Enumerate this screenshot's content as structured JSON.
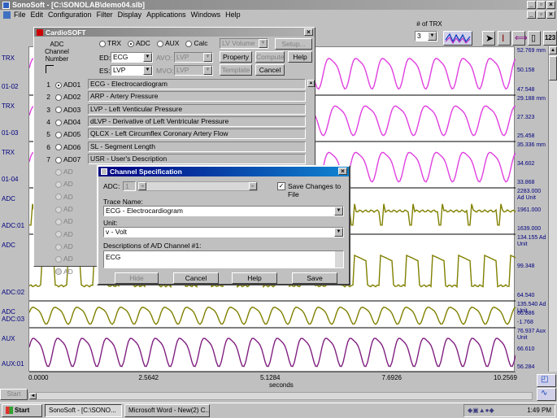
{
  "window": {
    "title": "SonoSoft - [C:\\SONOLAB\\demo04.slb]"
  },
  "menu": [
    "File",
    "Edit",
    "Configuration",
    "Filter",
    "Display",
    "Applications",
    "Windows",
    "Help"
  ],
  "toolbar": {
    "trx_count_label": "# of TRX",
    "trx_count_value": "3",
    "badge": "123"
  },
  "tracks": [
    {
      "name": "trx-1",
      "color": "#e040e0",
      "left_labels": [
        "TRX",
        "01-02"
      ],
      "right_labels": [
        "52.769 mm",
        "50.158",
        "47.548"
      ]
    },
    {
      "name": "trx-2",
      "color": "#e040e0",
      "left_labels": [
        "TRX",
        "01-03"
      ],
      "right_labels": [
        "29.188 mm",
        "27.323",
        "25.458"
      ]
    },
    {
      "name": "trx-3",
      "color": "#e040e0",
      "left_labels": [
        "TRX",
        "01-04"
      ],
      "right_labels": [
        "35.336 mm",
        "34.602",
        "33.868"
      ]
    },
    {
      "name": "adc-1",
      "color": "#808000",
      "left_labels": [
        "ADC",
        "ADC:01"
      ],
      "right_labels": [
        "2283.000 Ad Unit",
        "1961.000",
        "1639.000"
      ]
    },
    {
      "name": "adc-2",
      "color": "#808000",
      "left_labels": [
        "ADC",
        "ADC:02"
      ],
      "right_labels": [
        "134.155 Ad Unit",
        "99.348",
        "64.540"
      ]
    },
    {
      "name": "adc-3",
      "color": "#808000",
      "left_labels": [
        "ADC",
        "ADC:03"
      ],
      "right_labels": [
        "135.540 Ad Unit",
        "66.886",
        "-1.768"
      ]
    },
    {
      "name": "aux-1",
      "color": "#802080",
      "left_labels": [
        "AUX",
        "AUX:01"
      ],
      "right_labels": [
        "76.937 Aux Unit",
        "66.610",
        "56.284"
      ]
    }
  ],
  "x_axis": {
    "ticks": [
      "0.0000",
      "2.5642",
      "5.1284",
      "7.6926",
      "10.2569"
    ],
    "label": "seconds"
  },
  "sidebar": {
    "start_label": "Start"
  },
  "cardiosoft": {
    "title": "CardioSOFT",
    "adc_label": "ADC Channel Number",
    "modes": [
      "TRX",
      "ADC",
      "AUX",
      "Calc"
    ],
    "selected_mode": "ADC",
    "lv_volume": "LV Volume",
    "setup_label": "Setup...",
    "ed_label": "ED:",
    "ed_value": "ECG",
    "es_label": "ES:",
    "es_value": "LVP",
    "avo_label": "AVO:",
    "avo_value": "LVP",
    "mvo_label": "MVO:",
    "mvo_value": "LVP",
    "property_label": "Property",
    "compute_label": "Compute",
    "help_label": "Help",
    "template_label": "Template",
    "cancel_label": "Cancel",
    "channels": [
      {
        "num": "1",
        "ad": "AD01",
        "desc": "ECG    - Electrocardiogram",
        "selected": true
      },
      {
        "num": "2",
        "ad": "AD02",
        "desc": "ARP    - Artery Pressure"
      },
      {
        "num": "3",
        "ad": "AD03",
        "desc": "LVP    - Left Venticular Pressure"
      },
      {
        "num": "4",
        "ad": "AD04",
        "desc": "dLVP   - Derivative of Left Ventricular Pressure"
      },
      {
        "num": "5",
        "ad": "AD05",
        "desc": "QLCX   - Left Circumflex Coronary Artery Flow"
      },
      {
        "num": "6",
        "ad": "AD06",
        "desc": "SL     - Segment Length"
      },
      {
        "num": "7",
        "ad": "AD07",
        "desc": "USR    - User's Description"
      }
    ],
    "disabled_label": "AD"
  },
  "chanspec": {
    "title": "Channel Specification",
    "adc_label": "ADC:",
    "adc_value": "1",
    "save_changes_label": "Save Changes to File",
    "trace_name_label": "Trace Name:",
    "trace_name_value": "ECG    - Electrocardiogram",
    "unit_label": "Unit:",
    "unit_value": "v      - Volt",
    "desc_label": "Descriptions of A/D Channel #1:",
    "desc_value": "ECG",
    "hide_label": "Hide",
    "cancel_label": "Cancel",
    "help_label": "Help",
    "save_label": "Save"
  },
  "taskbar": {
    "start_label": "Start",
    "items": [
      "SonoSoft - [C:\\SONO...",
      "Microsoft Word - New(2) C..."
    ],
    "clock": "1:49 PM"
  }
}
